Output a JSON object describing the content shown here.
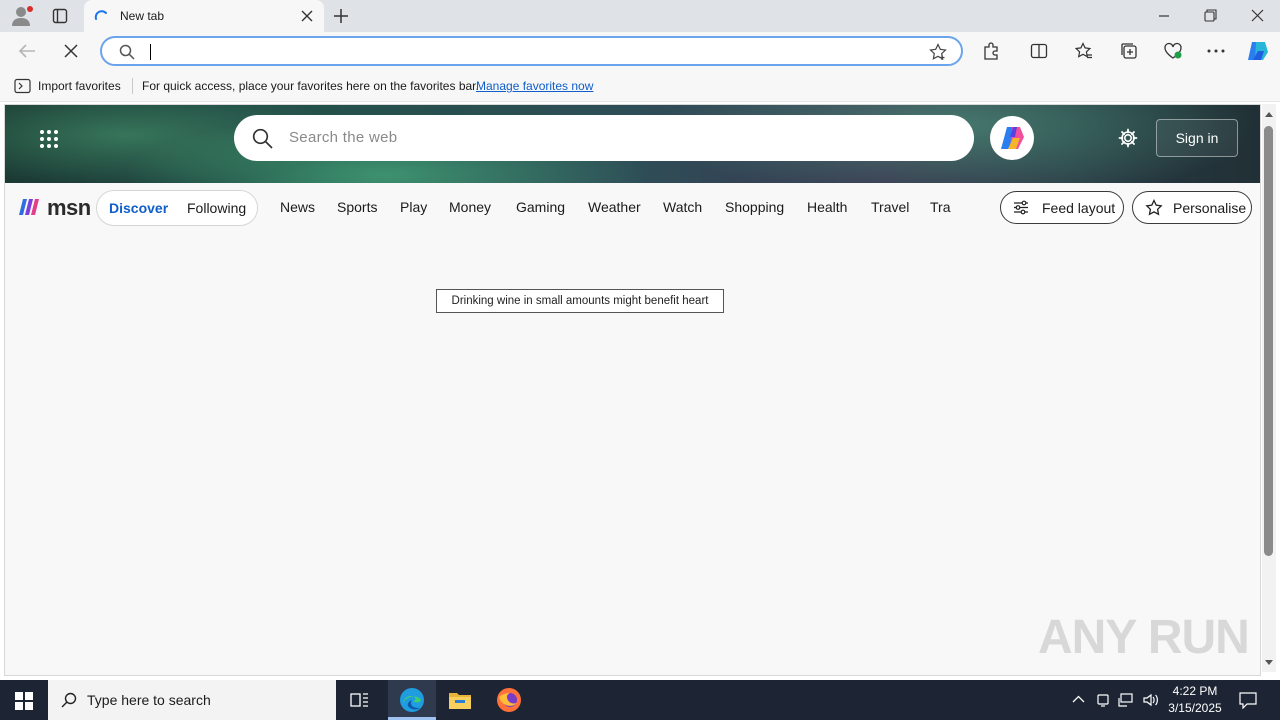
{
  "browser": {
    "tab_title": "New tab",
    "address_value": "",
    "favorites_bar": {
      "import_label": "Import favorites",
      "message": "For quick access, place your favorites here on the favorites bar.",
      "manage_link": "Manage favorites now"
    }
  },
  "msn": {
    "search_placeholder": "Search the web",
    "sign_in": "Sign in",
    "logo": "msn",
    "feed_tabs": [
      "Discover",
      "Following"
    ],
    "categories": [
      "News",
      "Sports",
      "Play",
      "Money",
      "Gaming",
      "Weather",
      "Watch",
      "Shopping",
      "Health",
      "Travel",
      "Trai"
    ],
    "feed_layout": "Feed layout",
    "personalise": "Personalise",
    "tooltip": "Drinking wine in small amounts might benefit heart"
  },
  "watermark": "ANY RUN",
  "taskbar": {
    "search_placeholder": "Type here to search",
    "time": "4:22 PM",
    "date": "3/15/2025"
  },
  "colors": {
    "accent": "#0f5ec9",
    "address_border": "#6aa4ec",
    "taskbar": "#1d2433"
  }
}
